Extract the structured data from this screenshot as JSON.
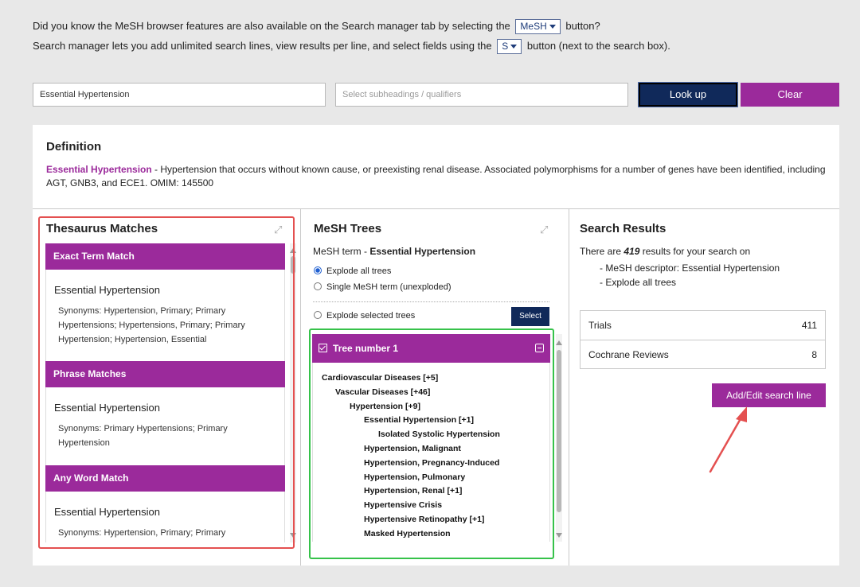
{
  "info": {
    "line1_a": "Did you know the MeSH browser features are also available on the Search manager tab by selecting the",
    "line1_btn": "MeSH",
    "line1_b": "button?",
    "line2_a": "Search manager lets you add unlimited search lines, view results per line, and select fields using the",
    "line2_btn": "S",
    "line2_b": "button (next to the search box)."
  },
  "search": {
    "term_value": "Essential Hypertension",
    "qualifier_placeholder": "Select subheadings / qualifiers",
    "lookup_label": "Look up",
    "clear_label": "Clear"
  },
  "definition": {
    "title": "Definition",
    "term": "Essential Hypertension",
    "text": " - Hypertension that occurs without known cause, or preexisting renal disease. Associated polymorphisms for a number of genes have been identified, including AGT, GNB3, and ECE1. OMIM: 145500"
  },
  "thesaurus": {
    "title": "Thesaurus Matches",
    "sections": [
      {
        "header": "Exact Term Match",
        "term": "Essential Hypertension",
        "synonyms": "Synonyms: Hypertension, Primary; Primary Hypertensions; Hypertensions, Primary; Primary Hypertension; Hypertension, Essential"
      },
      {
        "header": "Phrase Matches",
        "term": "Essential Hypertension",
        "synonyms": "Synonyms: Primary Hypertensions; Primary Hypertension"
      },
      {
        "header": "Any Word Match",
        "term": "Essential Hypertension",
        "synonyms": "Synonyms: Hypertension, Primary; Primary"
      }
    ]
  },
  "mesh": {
    "title": "MeSH Trees",
    "term_label": "MeSH term - ",
    "term_value": "Essential Hypertension",
    "option_explode_all": "Explode all trees",
    "option_single": "Single MeSH term (unexploded)",
    "option_explode_selected": "Explode selected trees",
    "select_label": "Select",
    "tree_header": "Tree number 1",
    "tree": [
      {
        "label": "Cardiovascular Diseases [+5]",
        "level": 0
      },
      {
        "label": "Vascular Diseases [+46]",
        "level": 1
      },
      {
        "label": "Hypertension [+9]",
        "level": 2
      },
      {
        "label": "Essential Hypertension [+1]",
        "level": 3
      },
      {
        "label": "Isolated Systolic Hypertension",
        "level": 4
      },
      {
        "label": "Hypertension, Malignant",
        "level": 3
      },
      {
        "label": "Hypertension, Pregnancy-Induced",
        "level": 3
      },
      {
        "label": "Hypertension, Pulmonary",
        "level": 3
      },
      {
        "label": "Hypertension, Renal [+1]",
        "level": 3
      },
      {
        "label": "Hypertensive Crisis",
        "level": 3
      },
      {
        "label": "Hypertensive Retinopathy [+1]",
        "level": 3
      },
      {
        "label": "Masked Hypertension",
        "level": 3
      }
    ]
  },
  "results": {
    "title": "Search Results",
    "summary_pre": "There are ",
    "count": "419",
    "summary_post": " results for your search on",
    "detail1": "- MeSH descriptor: Essential Hypertension",
    "detail2": "- Explode all trees",
    "rows": [
      {
        "label": "Trials",
        "value": "411"
      },
      {
        "label": "Cochrane Reviews",
        "value": "8"
      }
    ],
    "add_button": "Add/Edit search line"
  },
  "colors": {
    "accent_purple": "#9b2a9b",
    "navy": "#10295a",
    "highlight_red": "#e45050",
    "highlight_green": "#36c24a"
  }
}
